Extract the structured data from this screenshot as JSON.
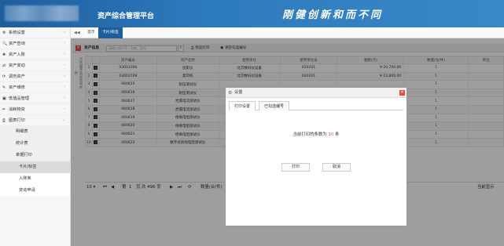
{
  "header": {
    "title": "资产综合管理平台",
    "slogan": "刚健创新和而不同"
  },
  "sidebar": {
    "items": [
      {
        "label": "系统设置",
        "icon": "gear-icon",
        "glyph": "⚙"
      },
      {
        "label": "资产查询",
        "icon": "search-icon",
        "glyph": "🔍"
      },
      {
        "label": "资产入账",
        "icon": "plus-icon",
        "glyph": "✚"
      },
      {
        "label": "资产变动",
        "icon": "swap-icon",
        "glyph": "⇄"
      },
      {
        "label": "调剂资产",
        "icon": "refresh-icon",
        "glyph": "⟳"
      },
      {
        "label": "资产维修",
        "icon": "wrench-icon",
        "glyph": "✎"
      },
      {
        "label": "低值品管理",
        "icon": "box-icon",
        "glyph": "▣"
      },
      {
        "label": "消耗物资",
        "icon": "edit-icon",
        "glyph": "✏"
      },
      {
        "label": "图表打印",
        "icon": "print-icon",
        "glyph": "⎙"
      }
    ],
    "sub": [
      "明细表",
      "统计表",
      "单据打印"
    ],
    "sub2": [
      "卡片/标签",
      "入账单",
      "变动申请"
    ]
  },
  "tabs": {
    "scroll": "◀◀",
    "home": "首页",
    "active": "卡片/标签"
  },
  "toolbar": {
    "close": "✕",
    "label": "资产信息",
    "search_placeholder": "请输入资产号、名称、型号",
    "search_icon": "⌕",
    "print_btn": "预览打印",
    "clear_btn": "清空勾选编号"
  },
  "side_search": "点击展开高级查询条件",
  "table": {
    "headers": [
      "",
      "",
      "资产编号",
      "资产名称",
      "使用单位",
      "使用单位号",
      "金额(元)",
      "数量(台/件)",
      "单位"
    ],
    "rows": [
      {
        "n": "1",
        "code": "03001006",
        "name": "投影仪",
        "unit": "北京数码仪设备",
        "unit_no": "020201",
        "amount": "¥ 20,700.00",
        "qty": "1"
      },
      {
        "n": "2",
        "code": "03003709",
        "name": "复印机",
        "unit": "北京数码仪设备",
        "unit_no": "020201",
        "amount": "¥ 12,800.00",
        "qty": "1"
      },
      {
        "n": "3",
        "code": "060615",
        "name": "耐压测试仪",
        "unit": "",
        "unit_no": "",
        "amount": "",
        "qty": "1"
      },
      {
        "n": "4",
        "code": "060616",
        "name": "耐压测试仪",
        "unit": "",
        "unit_no": "",
        "amount": "",
        "qty": "1"
      },
      {
        "n": "5",
        "code": "060617",
        "name": "泄漏电流测试仪",
        "unit": "",
        "unit_no": "",
        "amount": "",
        "qty": "1"
      },
      {
        "n": "6",
        "code": "060618",
        "name": "泄漏电流测试仪",
        "unit": "",
        "unit_no": "",
        "amount": "",
        "qty": "1"
      },
      {
        "n": "7",
        "code": "060619",
        "name": "绝缘电阻测试仪",
        "unit": "",
        "unit_no": "",
        "amount": "",
        "qty": "1"
      },
      {
        "n": "8",
        "code": "060620",
        "name": "绝缘电阻测试仪",
        "unit": "",
        "unit_no": "",
        "amount": "",
        "qty": "1"
      },
      {
        "n": "9",
        "code": "060621",
        "name": "绝缘电阻测试仪",
        "unit": "",
        "unit_no": "",
        "amount": "",
        "qty": "1"
      },
      {
        "n": "10",
        "code": "060622",
        "name": "数字式接地电阻测试仪",
        "unit": "",
        "unit_no": "",
        "amount": "",
        "qty": "1"
      }
    ]
  },
  "pager": {
    "page_size": "10",
    "first": "⏮",
    "prev": "◀",
    "page_label": "第",
    "page_input": "1",
    "total": "页,共 496 页",
    "next": "▶",
    "last": "⏭",
    "refresh": "⟳",
    "info": "数量(台/件)",
    "right": "当前显示"
  },
  "dialog": {
    "title": "设置",
    "close": "✕",
    "tab1": "打印设置",
    "tab2": "已勾选编号",
    "msg_prefix": "当前打印的条数为",
    "count": "10",
    "msg_suffix": "条",
    "print": "打印",
    "cancel": "取消"
  }
}
